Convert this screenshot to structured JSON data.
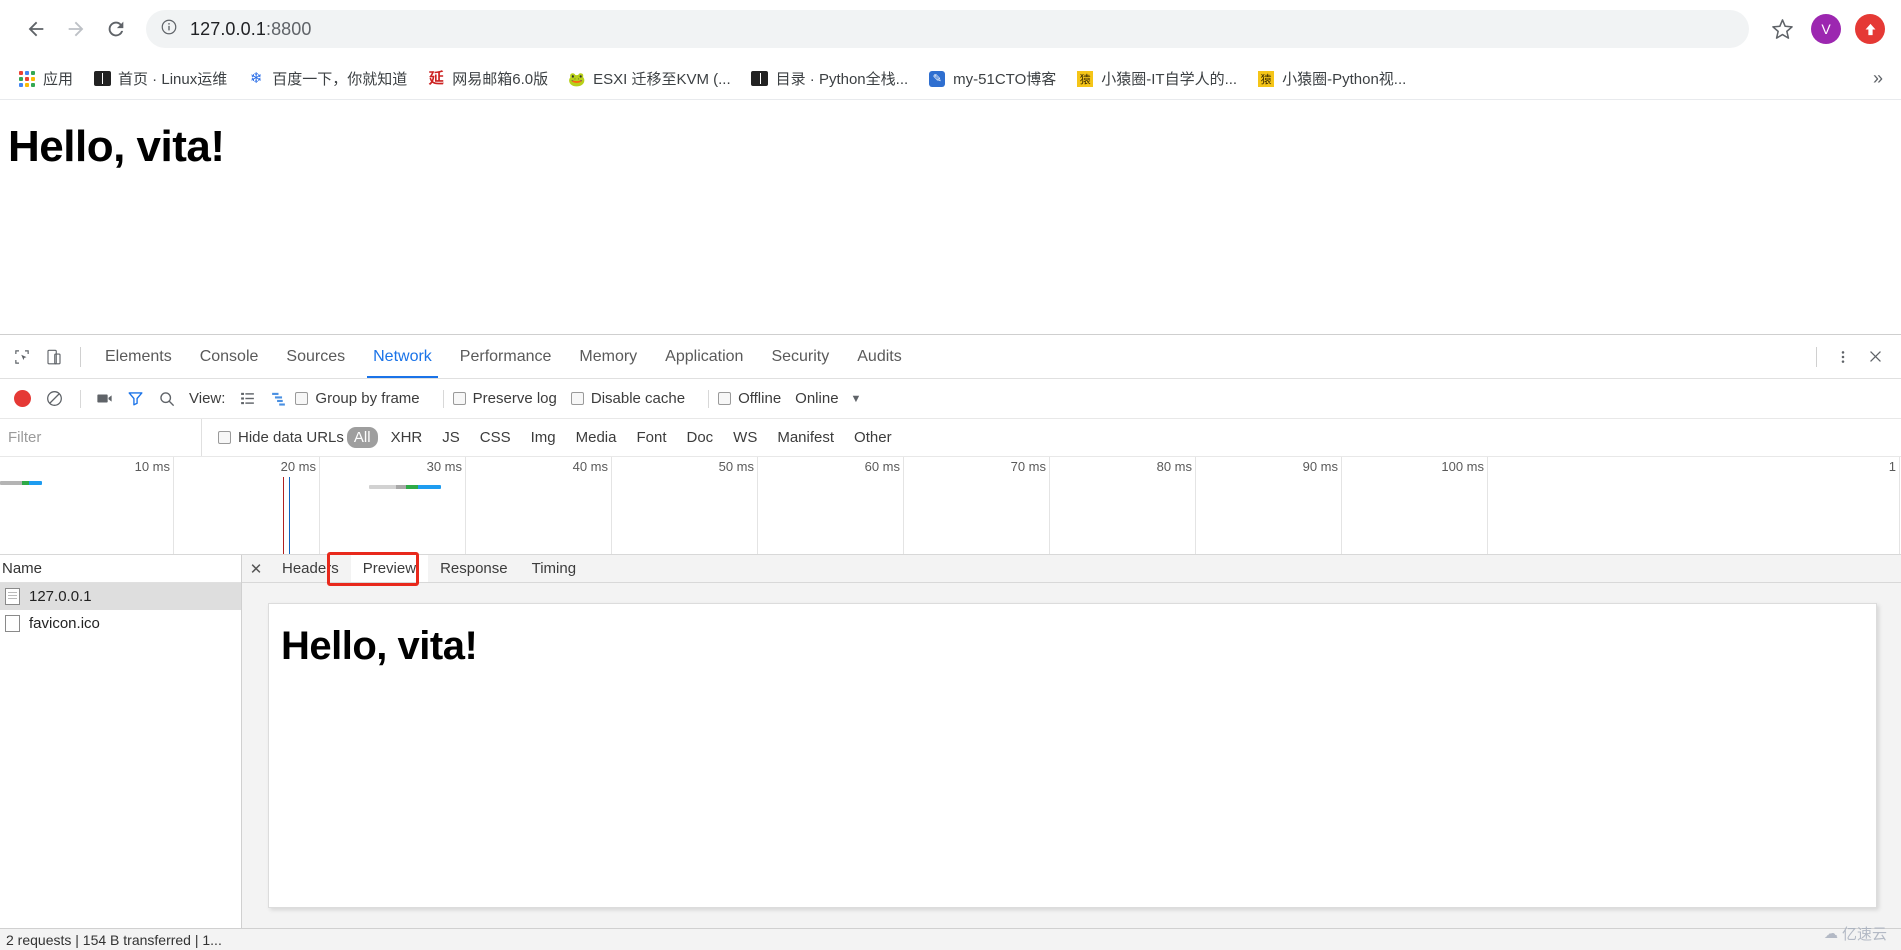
{
  "browser": {
    "back_icon": "back-arrow-icon",
    "forward_icon": "forward-arrow-icon",
    "reload_icon": "reload-icon",
    "info_icon": "page-info-icon",
    "url_host": "127.0.0.1",
    "url_port": ":8800",
    "star_icon": "bookmark-star-icon",
    "avatar_initial": "V",
    "update_icon": "update-arrow-icon",
    "accent": "#1a73e8"
  },
  "bookmarks": {
    "overflow_label": "»",
    "items": [
      {
        "label": "应用",
        "icon": "apps-grid-icon"
      },
      {
        "label": "首页 · Linux运维",
        "icon": "book-icon"
      },
      {
        "label": "百度一下，你就知道",
        "icon": "baidu-paw-icon"
      },
      {
        "label": "网易邮箱6.0版",
        "icon": "netease-mail-icon"
      },
      {
        "label": "ESXI 迁移至KVM (...",
        "icon": "frog-icon"
      },
      {
        "label": "目录 · Python全栈...",
        "icon": "book-icon"
      },
      {
        "label": "my-51CTO博客",
        "icon": "cto-pen-icon"
      },
      {
        "label": "小猿圈-IT自学人的...",
        "icon": "yuan-icon"
      },
      {
        "label": "小猿圈-Python视...",
        "icon": "yuan-icon"
      }
    ]
  },
  "page": {
    "heading": "Hello, vita!"
  },
  "devtools": {
    "inspect_icon": "inspect-cursor-icon",
    "device_icon": "device-toolbar-icon",
    "more_icon": "more-vertical-icon",
    "close_icon": "close-icon",
    "tabs": [
      {
        "label": "Elements",
        "active": false
      },
      {
        "label": "Console",
        "active": false
      },
      {
        "label": "Sources",
        "active": false
      },
      {
        "label": "Network",
        "active": true
      },
      {
        "label": "Performance",
        "active": false
      },
      {
        "label": "Memory",
        "active": false
      },
      {
        "label": "Application",
        "active": false
      },
      {
        "label": "Security",
        "active": false
      },
      {
        "label": "Audits",
        "active": false
      }
    ],
    "toolbar": {
      "record_icon": "record-dot-icon",
      "clear_icon": "clear-prohibited-icon",
      "capture_icon": "camera-screenshot-icon",
      "filter_icon": "funnel-filter-icon",
      "search_icon": "search-icon",
      "view_label": "View:",
      "view_list_icon": "list-view-icon",
      "view_waterfall_icon": "waterfall-view-icon",
      "group_by_frame": "Group by frame",
      "preserve_log": "Preserve log",
      "disable_cache": "Disable cache",
      "offline": "Offline",
      "throttling": "Online",
      "throttling_caret": "▼"
    },
    "filter": {
      "placeholder": "Filter",
      "value": "",
      "hide_data_urls": "Hide data URLs",
      "types": [
        "All",
        "XHR",
        "JS",
        "CSS",
        "Img",
        "Media",
        "Font",
        "Doc",
        "WS",
        "Manifest",
        "Other"
      ],
      "active_type": "All"
    },
    "timeline": {
      "ticks": [
        "10 ms",
        "20 ms",
        "30 ms",
        "40 ms",
        "50 ms",
        "60 ms",
        "70 ms",
        "80 ms",
        "90 ms",
        "100 ms",
        "1"
      ],
      "bars": [
        {
          "left_pct": 0.0,
          "width_pct": 2.7,
          "segments": [
            {
              "color": "#b4b4b4",
              "pct": 52
            },
            {
              "color": "#2eaa47",
              "pct": 16
            },
            {
              "color": "#1e9cf0",
              "pct": 32
            }
          ]
        },
        {
          "left_pct": 19.4,
          "width_pct": 4.8,
          "segments": [
            {
              "color": "#d2d2d2",
              "pct": 38
            },
            {
              "color": "#a8a8a8",
              "pct": 14
            },
            {
              "color": "#2eaa47",
              "pct": 16
            },
            {
              "color": "#1e9cf0",
              "pct": 32
            }
          ]
        }
      ],
      "events": [
        {
          "left_pct": 14.9,
          "color": "#b02020",
          "name": "dom-content-loaded-line"
        },
        {
          "left_pct": 15.2,
          "color": "#1565c0",
          "name": "load-event-line"
        }
      ]
    },
    "requests": {
      "column_header": "Name",
      "rows": [
        {
          "name": "127.0.0.1",
          "icon": "document-file-icon",
          "selected": true
        },
        {
          "name": "favicon.ico",
          "icon": "generic-file-icon",
          "selected": false
        }
      ]
    },
    "detail": {
      "tabs": [
        {
          "label": "Headers",
          "active": false
        },
        {
          "label": "Preview",
          "active": true
        },
        {
          "label": "Response",
          "active": false
        },
        {
          "label": "Timing",
          "active": false
        }
      ],
      "highlight_tab": "Preview",
      "highlight_color": "#e8291c",
      "preview_heading": "Hello, vita!"
    },
    "status": "2 requests | 154 B transferred | 1..."
  },
  "watermark": {
    "text": "亿速云",
    "icon": "cloud-icon"
  }
}
